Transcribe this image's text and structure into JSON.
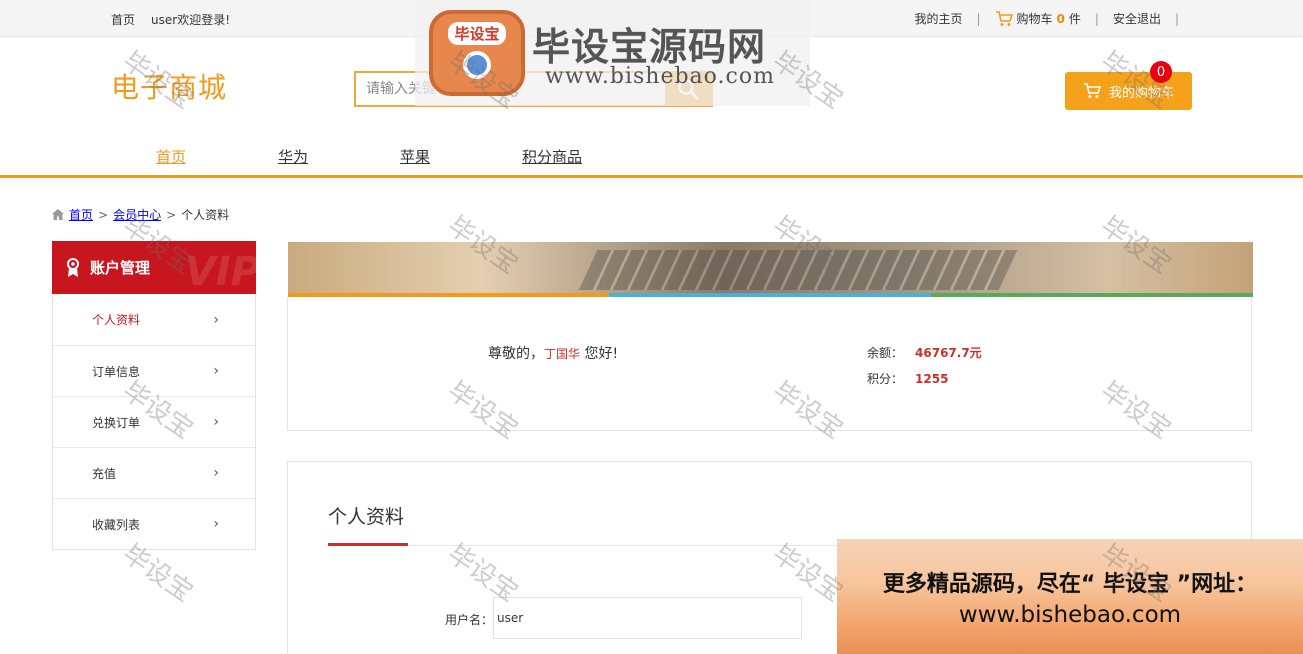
{
  "topbar": {
    "home": "首页",
    "welcome": "user欢迎登录!",
    "my_home": "我的主页",
    "cart_prefix": "购物车",
    "cart_count": "0",
    "cart_suffix": "件",
    "logout": "安全退出",
    "separator": "|"
  },
  "header": {
    "logo": "电子商城",
    "search_placeholder": "请输入关键字",
    "mycart_label": "我的购物车",
    "mycart_badge": "0"
  },
  "nav": {
    "items": [
      {
        "label": "首页",
        "active": true
      },
      {
        "label": "华为",
        "active": false
      },
      {
        "label": "苹果",
        "active": false
      },
      {
        "label": "积分商品",
        "active": false
      }
    ]
  },
  "breadcrumb": {
    "items": [
      "首页",
      "会员中心",
      "个人资料"
    ],
    "separator": ">"
  },
  "sidebar": {
    "title": "账户管理",
    "vip": "VIP",
    "items": [
      {
        "label": "个人资料",
        "active": true
      },
      {
        "label": "订单信息",
        "active": false
      },
      {
        "label": "兑换订单",
        "active": false
      },
      {
        "label": "充值",
        "active": false
      },
      {
        "label": "收藏列表",
        "active": false
      }
    ],
    "arrow": "›"
  },
  "banner": {
    "stripe_colors": [
      "#f39a1e",
      "#4ab0d9",
      "#5aa85a"
    ]
  },
  "info": {
    "greet_prefix": "尊敬的，",
    "username": "丁国华",
    "greet_suffix": " 您好!",
    "balance_label": "余额：",
    "balance_value": "46767.7元",
    "points_label": "积分：",
    "points_value": "1255"
  },
  "profile": {
    "title": "个人资料",
    "username_label": "用户名：",
    "username_value": "user"
  },
  "promo": {
    "line1": "更多精品源码，尽在“ 毕设宝 ”网址：",
    "line2": "www.bishebao.com"
  },
  "watermark": {
    "badge": "毕设宝",
    "title": "毕设宝源码网",
    "url": "www.bishebao.com",
    "text": "毕设宝"
  },
  "colors": {
    "accent": "#f39a1e",
    "red": "#c8161e",
    "price": "#c9312b"
  }
}
